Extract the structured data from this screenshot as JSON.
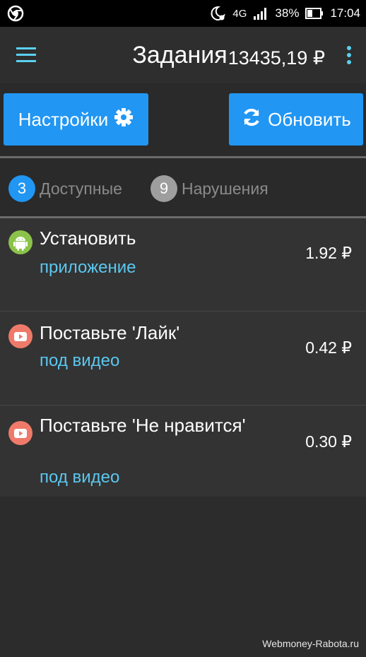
{
  "status_bar": {
    "network": "4G",
    "battery": "38%",
    "time": "17:04",
    "icons": [
      "browser-icon",
      "moon-alarm-icon",
      "signal-icon",
      "battery-icon"
    ]
  },
  "toolbar": {
    "title": "Задания",
    "balance": "13435,19 ₽",
    "accent_color": "#5ad1f0"
  },
  "actions": {
    "settings_label": "Настройки",
    "refresh_label": "Обновить",
    "button_color": "#2196f3"
  },
  "tabs": [
    {
      "count": "3",
      "label": "Доступные",
      "color": "#2196f3"
    },
    {
      "count": "9",
      "label": "Нарушения",
      "color": "#9e9e9e"
    }
  ],
  "tasks": [
    {
      "icon": "android-icon",
      "title": "Установить",
      "subtitle": "приложение",
      "price": "1.92 ₽"
    },
    {
      "icon": "youtube-icon",
      "title": "Поставьте 'Лайк'",
      "subtitle": "под видео",
      "price": "0.42 ₽"
    },
    {
      "icon": "youtube-icon",
      "title": "Поставьте 'Не нравится'",
      "subtitle": "под видео",
      "price": "0.30 ₽"
    }
  ],
  "watermark": "Webmoney-Rabota.ru"
}
